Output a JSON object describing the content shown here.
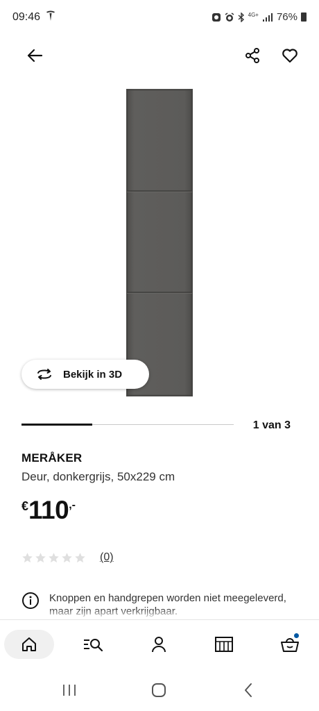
{
  "status_bar": {
    "time": "09:46",
    "carrier_icon": "tesla-logo-icon",
    "network": "4G+",
    "battery": "76%",
    "icons": [
      "silent-icon",
      "alarm-icon",
      "bluetooth-icon",
      "4g-plus-icon",
      "signal-icon",
      "battery-icon"
    ]
  },
  "top_bar": {
    "back_icon": "arrow-left-icon",
    "share_icon": "share-icon",
    "favorite_icon": "heart-icon"
  },
  "gallery": {
    "view_3d_label": "Bekijk in 3D",
    "view_3d_icon": "rotate-3d-icon",
    "position_text": "1 van 3",
    "current_index": 1,
    "total": 3,
    "product_color": "#5c5b59"
  },
  "product": {
    "name": "MERÅKER",
    "description": "Deur, donkergrijs, 50x229 cm",
    "price_currency": "€",
    "price_amount": "110",
    "price_suffix": ",-",
    "rating_value": 0,
    "rating_max": 5,
    "rating_count": "(0)"
  },
  "notice": {
    "icon": "info-icon",
    "text": "Knoppen en handgrepen worden niet meegeleverd, maar zijn apart verkrijgbaar."
  },
  "bottom_nav": {
    "items": [
      {
        "name": "home",
        "icon": "home-icon",
        "active": true
      },
      {
        "name": "search",
        "icon": "search-list-icon",
        "active": false
      },
      {
        "name": "profile",
        "icon": "person-icon",
        "active": false
      },
      {
        "name": "store",
        "icon": "store-icon",
        "active": false
      },
      {
        "name": "cart",
        "icon": "shopping-bag-icon",
        "active": false,
        "badge_color": "#0058a3"
      }
    ]
  },
  "system_nav": {
    "recents_icon": "recents-icon",
    "home_icon": "home-circle-icon",
    "back_icon": "chevron-left-icon"
  }
}
